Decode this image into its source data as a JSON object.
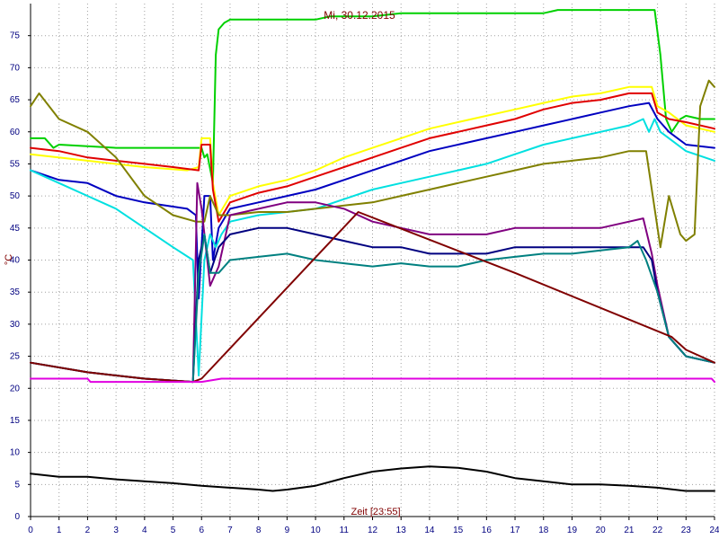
{
  "chart_data": {
    "type": "line",
    "title": "Mi, 30.12.2015",
    "xlabel": "Zeit [23:55]",
    "ylabel": "°C",
    "xlim": [
      0,
      24
    ],
    "ylim": [
      0,
      80
    ],
    "grid": true,
    "x_ticks": [
      "0",
      "1",
      "2",
      "3",
      "4",
      "5",
      "6",
      "7",
      "8",
      "9",
      "10",
      "11",
      "12",
      "13",
      "14",
      "15",
      "16",
      "17",
      "18",
      "19",
      "20",
      "21",
      "22",
      "23",
      "24"
    ],
    "y_ticks": [
      "0",
      "5",
      "10",
      "15",
      "20",
      "25",
      "30",
      "35",
      "40",
      "45",
      "50",
      "55",
      "60",
      "65",
      "70",
      "75"
    ],
    "series": [
      {
        "color": "#00d000",
        "points": [
          [
            0,
            59
          ],
          [
            0.5,
            59
          ],
          [
            0.8,
            57.5
          ],
          [
            1,
            58
          ],
          [
            3,
            57.5
          ],
          [
            6,
            57.5
          ],
          [
            6.1,
            56
          ],
          [
            6.2,
            56.5
          ],
          [
            6.4,
            52
          ],
          [
            6.5,
            72
          ],
          [
            6.6,
            76
          ],
          [
            6.8,
            77
          ],
          [
            7,
            77.5
          ],
          [
            10,
            77.5
          ],
          [
            10.5,
            78
          ],
          [
            12,
            78
          ],
          [
            13,
            78.5
          ],
          [
            18,
            78.5
          ],
          [
            18.5,
            79
          ],
          [
            21,
            79
          ],
          [
            21.9,
            79
          ],
          [
            22.1,
            72
          ],
          [
            22.3,
            62
          ],
          [
            22.5,
            60
          ],
          [
            22.8,
            62
          ],
          [
            23,
            62.5
          ],
          [
            23.5,
            62
          ],
          [
            24,
            62
          ]
        ]
      },
      {
        "color": "#ffff00",
        "points": [
          [
            0,
            56.5
          ],
          [
            2,
            55.5
          ],
          [
            4,
            54.5
          ],
          [
            5.5,
            54
          ],
          [
            5.9,
            54.5
          ],
          [
            6,
            59
          ],
          [
            6.3,
            59
          ],
          [
            6.4,
            52
          ],
          [
            6.6,
            47
          ],
          [
            7,
            50
          ],
          [
            8,
            51.5
          ],
          [
            9,
            52.5
          ],
          [
            10,
            54
          ],
          [
            11,
            56
          ],
          [
            12,
            57.5
          ],
          [
            13,
            59
          ],
          [
            14,
            60.5
          ],
          [
            15,
            61.5
          ],
          [
            16,
            62.5
          ],
          [
            17,
            63.5
          ],
          [
            18,
            64.5
          ],
          [
            19,
            65.5
          ],
          [
            20,
            66
          ],
          [
            21,
            67
          ],
          [
            21.8,
            67
          ],
          [
            22,
            64
          ],
          [
            22.4,
            63
          ],
          [
            23,
            61
          ],
          [
            24,
            60
          ]
        ]
      },
      {
        "color": "#e00000",
        "points": [
          [
            0,
            57.5
          ],
          [
            1,
            57
          ],
          [
            2,
            56
          ],
          [
            3,
            55.5
          ],
          [
            4,
            55
          ],
          [
            5,
            54.5
          ],
          [
            5.9,
            54
          ],
          [
            6,
            58
          ],
          [
            6.3,
            58
          ],
          [
            6.4,
            51
          ],
          [
            6.6,
            46
          ],
          [
            7,
            49
          ],
          [
            8,
            50.5
          ],
          [
            9,
            51.5
          ],
          [
            10,
            53
          ],
          [
            11,
            54.5
          ],
          [
            12,
            56
          ],
          [
            13,
            57.5
          ],
          [
            14,
            59
          ],
          [
            15,
            60
          ],
          [
            16,
            61
          ],
          [
            17,
            62
          ],
          [
            18,
            63.5
          ],
          [
            19,
            64.5
          ],
          [
            20,
            65
          ],
          [
            21,
            66
          ],
          [
            21.8,
            66
          ],
          [
            22,
            63
          ],
          [
            22.4,
            62
          ],
          [
            23,
            61.5
          ],
          [
            24,
            60.5
          ]
        ]
      },
      {
        "color": "#0000c0",
        "points": [
          [
            0,
            54
          ],
          [
            1,
            52.5
          ],
          [
            2,
            52
          ],
          [
            3,
            50
          ],
          [
            4,
            49
          ],
          [
            5.5,
            48
          ],
          [
            5.8,
            47
          ],
          [
            5.9,
            34
          ],
          [
            6.1,
            50
          ],
          [
            6.3,
            50
          ],
          [
            6.4,
            40
          ],
          [
            6.6,
            45
          ],
          [
            7,
            48
          ],
          [
            8,
            49
          ],
          [
            9,
            50
          ],
          [
            10,
            51
          ],
          [
            11,
            52.5
          ],
          [
            12,
            54
          ],
          [
            13,
            55.5
          ],
          [
            14,
            57
          ],
          [
            15,
            58
          ],
          [
            16,
            59
          ],
          [
            17,
            60
          ],
          [
            18,
            61
          ],
          [
            19,
            62
          ],
          [
            20,
            63
          ],
          [
            21,
            64
          ],
          [
            21.7,
            64.5
          ],
          [
            22,
            62
          ],
          [
            22.4,
            60
          ],
          [
            23,
            58
          ],
          [
            24,
            57.5
          ]
        ]
      },
      {
        "color": "#00e0e0",
        "points": [
          [
            0,
            54
          ],
          [
            1,
            52
          ],
          [
            2,
            50
          ],
          [
            3,
            48
          ],
          [
            4,
            45
          ],
          [
            5,
            42
          ],
          [
            5.7,
            40
          ],
          [
            5.9,
            22
          ],
          [
            6.1,
            40
          ],
          [
            6.3,
            44
          ],
          [
            6.5,
            42
          ],
          [
            6.7,
            44
          ],
          [
            7,
            46
          ],
          [
            8,
            47
          ],
          [
            9,
            47.5
          ],
          [
            10,
            48
          ],
          [
            11,
            49.5
          ],
          [
            12,
            51
          ],
          [
            13,
            52
          ],
          [
            14,
            53
          ],
          [
            15,
            54
          ],
          [
            16,
            55
          ],
          [
            17,
            56.5
          ],
          [
            18,
            58
          ],
          [
            19,
            59
          ],
          [
            20,
            60
          ],
          [
            21,
            61
          ],
          [
            21.5,
            62
          ],
          [
            21.7,
            60
          ],
          [
            21.9,
            62
          ],
          [
            22.1,
            60
          ],
          [
            22.4,
            59
          ],
          [
            23,
            57
          ],
          [
            24,
            55.5
          ]
        ]
      },
      {
        "color": "#808000",
        "points": [
          [
            0,
            64
          ],
          [
            0.3,
            66
          ],
          [
            1,
            62
          ],
          [
            2,
            60
          ],
          [
            3,
            56
          ],
          [
            4,
            50
          ],
          [
            5,
            47
          ],
          [
            5.8,
            46
          ],
          [
            6.1,
            46
          ],
          [
            6.3,
            50
          ],
          [
            6.6,
            47
          ],
          [
            7,
            47
          ],
          [
            8,
            47.5
          ],
          [
            9,
            47.5
          ],
          [
            10,
            48
          ],
          [
            11,
            48.5
          ],
          [
            12,
            49
          ],
          [
            13,
            50
          ],
          [
            14,
            51
          ],
          [
            15,
            52
          ],
          [
            16,
            53
          ],
          [
            17,
            54
          ],
          [
            18,
            55
          ],
          [
            19,
            55.5
          ],
          [
            20,
            56
          ],
          [
            21,
            57
          ],
          [
            21.6,
            57
          ],
          [
            21.9,
            48
          ],
          [
            22.1,
            42
          ],
          [
            22.4,
            50
          ],
          [
            22.8,
            44
          ],
          [
            23,
            43
          ],
          [
            23.3,
            44
          ],
          [
            23.5,
            64
          ],
          [
            23.8,
            68
          ],
          [
            24,
            67
          ]
        ]
      },
      {
        "color": "#800080",
        "points": [
          [
            0,
            24
          ],
          [
            2,
            22.5
          ],
          [
            4,
            21.5
          ],
          [
            5.7,
            21
          ],
          [
            5.85,
            52
          ],
          [
            6,
            48
          ],
          [
            6.3,
            36
          ],
          [
            6.6,
            39
          ],
          [
            7,
            47
          ],
          [
            8,
            48
          ],
          [
            9,
            49
          ],
          [
            10,
            49
          ],
          [
            11,
            48
          ],
          [
            12,
            46
          ],
          [
            13,
            45
          ],
          [
            14,
            44
          ],
          [
            15,
            44
          ],
          [
            16,
            44
          ],
          [
            17,
            45
          ],
          [
            18,
            45
          ],
          [
            19,
            45
          ],
          [
            20,
            45
          ],
          [
            21,
            46
          ],
          [
            21.5,
            46.5
          ],
          [
            21.8,
            41
          ],
          [
            22,
            36
          ],
          [
            22.4,
            28
          ],
          [
            23,
            25
          ],
          [
            24,
            24
          ]
        ]
      },
      {
        "color": "#000080",
        "points": [
          [
            0,
            24
          ],
          [
            2,
            22.5
          ],
          [
            4,
            21.5
          ],
          [
            5.7,
            21
          ],
          [
            5.9,
            40
          ],
          [
            6.1,
            44
          ],
          [
            6.3,
            38
          ],
          [
            6.6,
            42
          ],
          [
            7,
            44
          ],
          [
            8,
            45
          ],
          [
            9,
            45
          ],
          [
            10,
            44
          ],
          [
            11,
            43
          ],
          [
            12,
            42
          ],
          [
            13,
            42
          ],
          [
            14,
            41
          ],
          [
            15,
            41
          ],
          [
            16,
            41
          ],
          [
            17,
            42
          ],
          [
            18,
            42
          ],
          [
            19,
            42
          ],
          [
            20,
            42
          ],
          [
            21,
            42
          ],
          [
            21.5,
            42
          ],
          [
            21.8,
            40
          ],
          [
            22,
            35
          ],
          [
            22.4,
            28
          ],
          [
            23,
            25
          ],
          [
            24,
            24
          ]
        ]
      },
      {
        "color": "#008080",
        "points": [
          [
            0,
            24
          ],
          [
            2,
            22.5
          ],
          [
            4,
            21.5
          ],
          [
            5.7,
            21
          ],
          [
            5.9,
            38
          ],
          [
            6.1,
            44
          ],
          [
            6.3,
            38
          ],
          [
            6.6,
            38
          ],
          [
            7,
            40
          ],
          [
            8,
            40.5
          ],
          [
            9,
            41
          ],
          [
            10,
            40
          ],
          [
            11,
            39.5
          ],
          [
            12,
            39
          ],
          [
            13,
            39.5
          ],
          [
            14,
            39
          ],
          [
            15,
            39
          ],
          [
            16,
            40
          ],
          [
            17,
            40.5
          ],
          [
            18,
            41
          ],
          [
            19,
            41
          ],
          [
            20,
            41.5
          ],
          [
            21,
            42
          ],
          [
            21.3,
            43
          ],
          [
            21.6,
            40
          ],
          [
            22,
            35
          ],
          [
            22.4,
            28
          ],
          [
            23,
            25
          ],
          [
            24,
            24
          ]
        ]
      },
      {
        "color": "#800000",
        "points": [
          [
            0,
            24
          ],
          [
            2,
            22.5
          ],
          [
            4,
            21.5
          ],
          [
            5.7,
            21
          ],
          [
            6,
            21.5
          ],
          [
            11.5,
            47.5
          ],
          [
            17,
            38
          ],
          [
            22.5,
            28
          ],
          [
            23,
            26
          ],
          [
            24,
            24
          ]
        ]
      },
      {
        "color": "#e000e0",
        "points": [
          [
            0,
            21.5
          ],
          [
            2,
            21.5
          ],
          [
            2.1,
            21
          ],
          [
            6,
            21
          ],
          [
            6.7,
            21.5
          ],
          [
            23.9,
            21.5
          ],
          [
            24,
            21
          ]
        ]
      },
      {
        "color": "#000000",
        "points": [
          [
            0,
            6.7
          ],
          [
            1,
            6.2
          ],
          [
            2,
            6.2
          ],
          [
            3,
            5.8
          ],
          [
            4,
            5.5
          ],
          [
            5,
            5.2
          ],
          [
            6,
            4.8
          ],
          [
            7,
            4.5
          ],
          [
            8,
            4.2
          ],
          [
            8.5,
            4
          ],
          [
            9,
            4.2
          ],
          [
            10,
            4.8
          ],
          [
            11,
            6
          ],
          [
            12,
            7
          ],
          [
            13,
            7.5
          ],
          [
            14,
            7.8
          ],
          [
            15,
            7.6
          ],
          [
            16,
            7
          ],
          [
            17,
            6
          ],
          [
            18,
            5.5
          ],
          [
            19,
            5
          ],
          [
            20,
            5
          ],
          [
            21,
            4.8
          ],
          [
            22,
            4.5
          ],
          [
            23,
            4
          ],
          [
            24,
            4
          ]
        ]
      }
    ]
  }
}
